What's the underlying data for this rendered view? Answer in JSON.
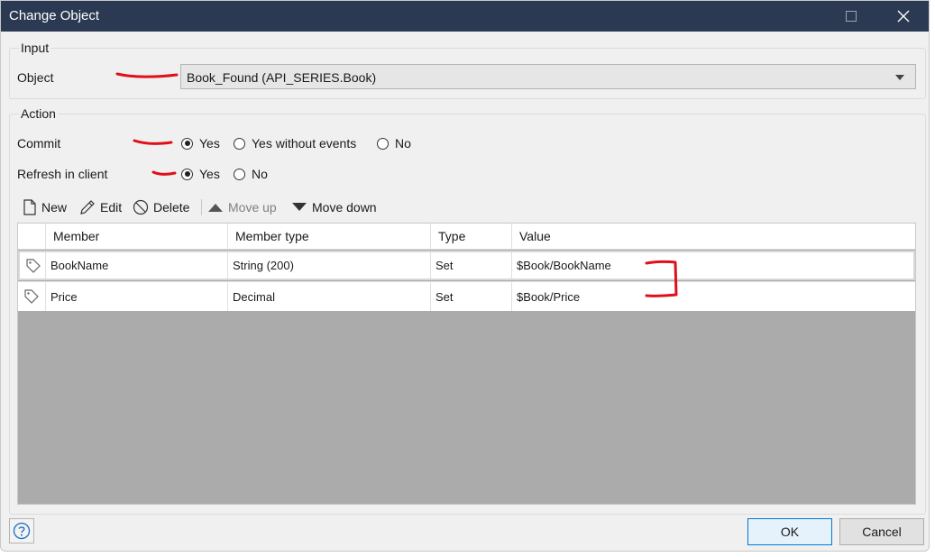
{
  "window": {
    "title": "Change Object",
    "maximize_icon": "maximize-icon",
    "close_icon": "close-icon",
    "title_bar_color": "#2b3a52"
  },
  "input_group": {
    "legend": "Input",
    "object_label": "Object",
    "object_value": "Book_Found (API_SERIES.Book)"
  },
  "action_group": {
    "legend": "Action",
    "commit_label": "Commit",
    "commit_options": [
      "Yes",
      "Yes without events",
      "No"
    ],
    "commit_selected": "Yes",
    "refresh_label": "Refresh in client",
    "refresh_options": [
      "Yes",
      "No"
    ],
    "refresh_selected": "Yes"
  },
  "toolbar": {
    "new_label": "New",
    "edit_label": "Edit",
    "delete_label": "Delete",
    "move_up_label": "Move up",
    "move_down_label": "Move down"
  },
  "table": {
    "columns": [
      "Member",
      "Member type",
      "Type",
      "Value"
    ],
    "rows": [
      {
        "member": "BookName",
        "member_type": "String (200)",
        "type": "Set",
        "value": "$Book/BookName"
      },
      {
        "member": "Price",
        "member_type": "Decimal",
        "type": "Set",
        "value": "$Book/Price"
      }
    ]
  },
  "footer": {
    "help_icon": "help-icon",
    "ok_label": "OK",
    "cancel_label": "Cancel"
  },
  "colors": {
    "annotation_red": "#e0101a",
    "grid_empty": "#ababab",
    "ok_border": "#0078d7"
  }
}
